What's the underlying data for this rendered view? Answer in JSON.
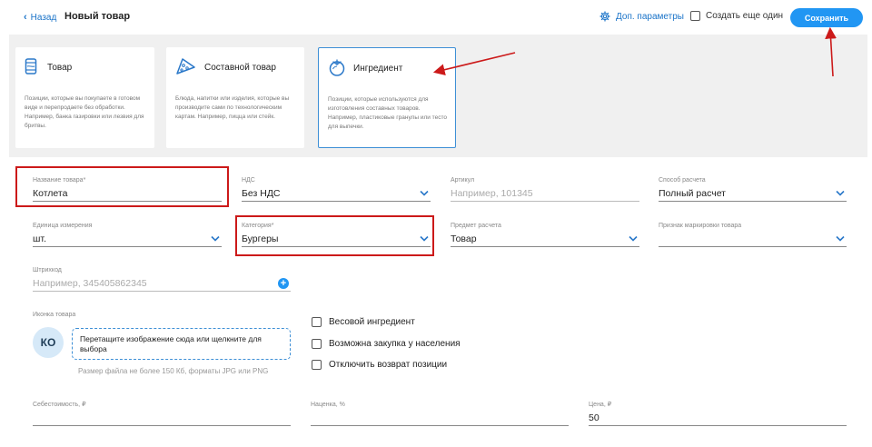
{
  "header": {
    "back_label": "Назад",
    "title": "Новый товар",
    "extra_params_label": "Доп. параметры",
    "create_more_label": "Создать еще один",
    "save_label": "Сохранить"
  },
  "types": [
    {
      "title": "Товар",
      "description": "Позиции, которые вы покупаете в готовом виде и перепродаете без обработки. Например, банка газировки или лезвия для бритвы.",
      "icon": "can-icon",
      "selected": false
    },
    {
      "title": "Составной товар",
      "description": "Блюда, напитки или изделия, которые вы производите сами по технологическим картам. Например, пицца или стейк.",
      "icon": "pizza-icon",
      "selected": false
    },
    {
      "title": "Ингредиент",
      "description": "Позиции, которые используются для изготовления составных товаров. Например, пластиковые гранулы или тесто для выпечки.",
      "icon": "tomato-icon",
      "selected": true
    }
  ],
  "fields": {
    "name": {
      "label": "Название товара",
      "required": "*",
      "value": "Котлета"
    },
    "vat": {
      "label": "НДС",
      "value": "Без НДС"
    },
    "article": {
      "label": "Артикул",
      "placeholder": "Например, 101345"
    },
    "payment_method": {
      "label": "Способ расчета",
      "value": "Полный расчет"
    },
    "unit": {
      "label": "Единица измерения",
      "value": "шт."
    },
    "category": {
      "label": "Категория",
      "required": "*",
      "value": "Бургеры"
    },
    "payment_subject": {
      "label": "Предмет расчета",
      "value": "Товар"
    },
    "marking": {
      "label": "Признак маркировки товара",
      "value": ""
    },
    "barcode": {
      "label": "Штрихкод",
      "placeholder": "Например, 345405862345"
    },
    "cost": {
      "label": "Себестоимость, ₽",
      "value": ""
    },
    "markup": {
      "label": "Наценка, %",
      "value": ""
    },
    "price": {
      "label": "Цена, ₽",
      "value": "50"
    }
  },
  "icon_section": {
    "label": "Иконка товара",
    "avatar_text": "КО",
    "drop_text": "Перетащите изображение сюда или щелкните для выбора",
    "hint": "Размер файла не более 150 Кб, форматы JPG или PNG"
  },
  "options": [
    {
      "label": "Весовой ингредиент",
      "checked": false
    },
    {
      "label": "Возможна закупка у населения",
      "checked": false
    },
    {
      "label": "Отключить возврат позиции",
      "checked": false
    }
  ],
  "colors": {
    "accent": "#2196f3",
    "annotation": "#cc1a1a",
    "panel": "#f0f0f0"
  }
}
